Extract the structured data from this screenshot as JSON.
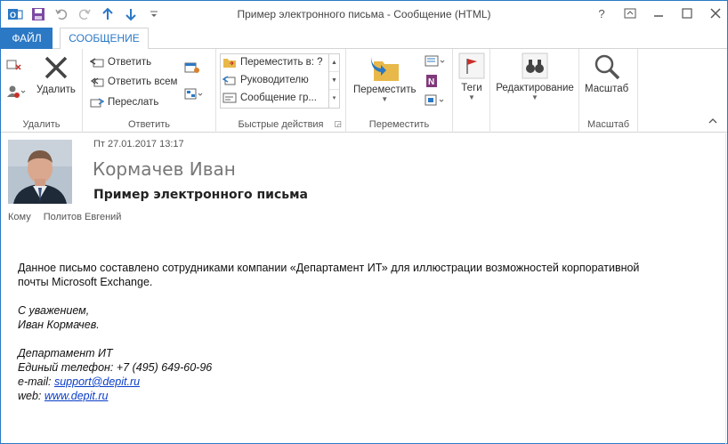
{
  "window": {
    "title": "Пример электронного письма - Сообщение (HTML)",
    "accent": "#2b78c5",
    "controls": [
      "?",
      "restore",
      "minimize",
      "maximize",
      "close"
    ]
  },
  "quick_access": [
    "save-icon",
    "undo-icon",
    "redo-icon",
    "up-arrow-icon",
    "down-arrow-icon",
    "customize-icon"
  ],
  "tabs": {
    "file": "ФАЙЛ",
    "message": "СООБЩЕНИЕ"
  },
  "ribbon": {
    "delete_group": {
      "label": "Удалить",
      "delete": "Удалить"
    },
    "respond_group": {
      "label": "Ответить",
      "reply": "Ответить",
      "reply_all": "Ответить всем",
      "forward": "Переслать"
    },
    "quick_steps": {
      "label": "Быстрые действия",
      "items": [
        "Переместить в: ?",
        "Руководителю",
        "Сообщение гр..."
      ]
    },
    "move_group": {
      "label": "Переместить",
      "move": "Переместить"
    },
    "tags_group": {
      "label": "",
      "tags": "Теги"
    },
    "editing_group": {
      "label": "",
      "editing": "Редактирование"
    },
    "zoom_group": {
      "label": "Масштаб",
      "zoom": "Масштаб"
    }
  },
  "message": {
    "date": "Пт 27.01.2017 13:17",
    "sender": "Кормачев Иван",
    "subject": "Пример электронного письма",
    "to_label": "Кому",
    "to_value": "Политов Евгений",
    "body": {
      "line1": "Данное письмо составлено сотрудниками компании «Департамент ИТ» для иллюстрации возможностей корпоративной",
      "line2": "почты Microsoft Exchange.",
      "greeting": "С уважением,",
      "name": "Иван Кормачев.",
      "company": "Департамент ИТ",
      "phone": "Единый телефон: +7 (495) 649-60-96",
      "email_label": "e-mail: ",
      "email": "support@depit.ru",
      "web_label": "web: ",
      "web": "www.depit.ru"
    }
  }
}
